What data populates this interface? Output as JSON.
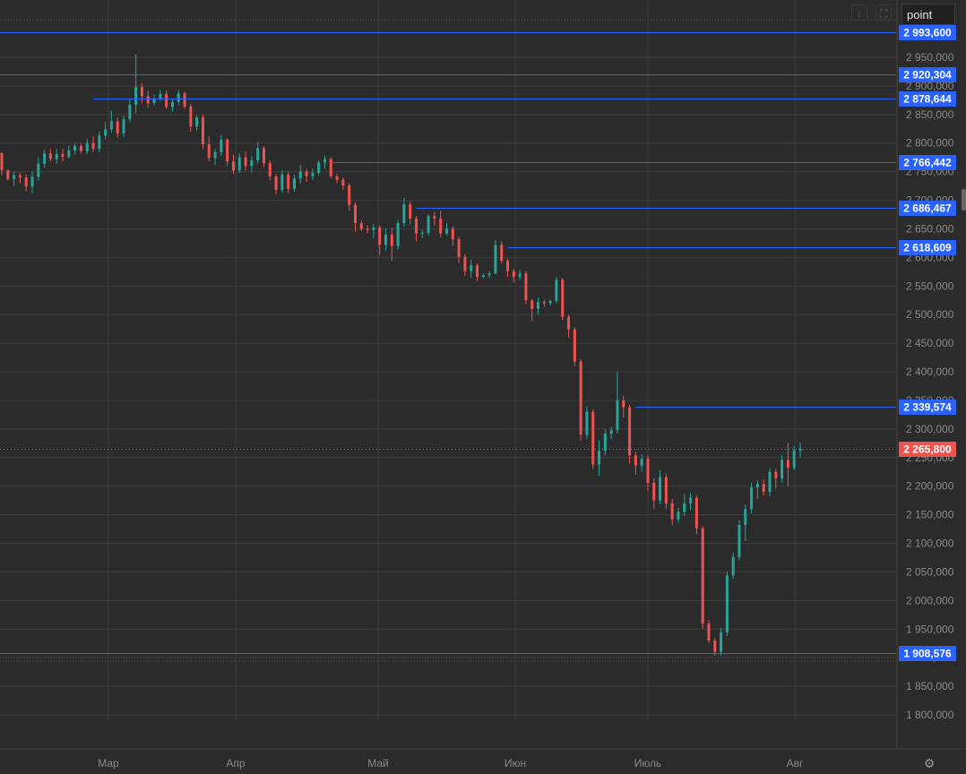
{
  "toolbar": {
    "symbol": "point",
    "download_icon": "download-icon",
    "fullscreen_icon": "fullscreen-icon",
    "settings_icon": "gear-icon"
  },
  "colors": {
    "background": "#2b2b2b",
    "grid": "#3f3f3f",
    "up": "#26a69a",
    "down": "#ef5350",
    "level_line": "#2962ff",
    "level_badge": "#2962ff",
    "price_badge": "#ef5350",
    "axis_text": "#8a8a8a"
  },
  "chart_data": {
    "type": "candlestick",
    "y_range": [
      1765000,
      3020000
    ],
    "y_ticks": [
      "1 800,000",
      "1 850,000",
      "1 900,000",
      "1 950,000",
      "2 000,000",
      "2 050,000",
      "2 100,000",
      "2 150,000",
      "2 200,000",
      "2 250,000",
      "2 300,000",
      "2 350,000",
      "2 400,000",
      "2 450,000",
      "2 500,000",
      "2 550,000",
      "2 600,000",
      "2 650,000",
      "2 700,000",
      "2 750,000",
      "2 800,000",
      "2 850,000",
      "2 900,000",
      "2 950,000"
    ],
    "x_ticks": [
      "Мар",
      "Апр",
      "Май",
      "Июн",
      "Июль",
      "Авг"
    ],
    "levels": [
      {
        "label": "2 993,600",
        "value": 2993600,
        "from": 0
      },
      {
        "label": "2 920,304",
        "value": 2920304,
        "from": 0
      },
      {
        "label": "2 878,644",
        "value": 2878644,
        "from": 15
      },
      {
        "label": "2 766,442",
        "value": 2766442,
        "from": 54
      },
      {
        "label": "2 686,467",
        "value": 2686467,
        "from": 68
      },
      {
        "label": "2 618,609",
        "value": 2618609,
        "from": 83
      },
      {
        "label": "2 339,574",
        "value": 2339574,
        "from": 104
      },
      {
        "label": "1 908,576",
        "value": 1908576,
        "from": 0
      }
    ],
    "current_price": {
      "label": "2 265,800",
      "value": 2265800
    },
    "candles": [
      [
        2783000,
        2783000,
        2744000,
        2753000
      ],
      [
        2753000,
        2752000,
        2734000,
        2737000
      ],
      [
        2737000,
        2751000,
        2725000,
        2744000
      ],
      [
        2744000,
        2748000,
        2730000,
        2740000
      ],
      [
        2740000,
        2745000,
        2716000,
        2724000
      ],
      [
        2724000,
        2750000,
        2712000,
        2741000
      ],
      [
        2741000,
        2775000,
        2735000,
        2764000
      ],
      [
        2764000,
        2788000,
        2757000,
        2782000
      ],
      [
        2782000,
        2790000,
        2768000,
        2772000
      ],
      [
        2772000,
        2790000,
        2764000,
        2781000
      ],
      [
        2781000,
        2790000,
        2768000,
        2776000
      ],
      [
        2776000,
        2795000,
        2773000,
        2787000
      ],
      [
        2787000,
        2800000,
        2780000,
        2795000
      ],
      [
        2795000,
        2800000,
        2782000,
        2786000
      ],
      [
        2786000,
        2807000,
        2781000,
        2800000
      ],
      [
        2800000,
        2812000,
        2785000,
        2790000
      ],
      [
        2790000,
        2820000,
        2784000,
        2813000
      ],
      [
        2813000,
        2837000,
        2806000,
        2824000
      ],
      [
        2824000,
        2857000,
        2818000,
        2838000
      ],
      [
        2838000,
        2845000,
        2810000,
        2817000
      ],
      [
        2817000,
        2848000,
        2811000,
        2842000
      ],
      [
        2842000,
        2878000,
        2837000,
        2867000
      ],
      [
        2867000,
        2955000,
        2852000,
        2898000
      ],
      [
        2898000,
        2905000,
        2870000,
        2882000
      ],
      [
        2882000,
        2892000,
        2862000,
        2870000
      ],
      [
        2870000,
        2885000,
        2866000,
        2878000
      ],
      [
        2878000,
        2893000,
        2874000,
        2886000
      ],
      [
        2886000,
        2892000,
        2860000,
        2863000
      ],
      [
        2863000,
        2878000,
        2855000,
        2872000
      ],
      [
        2872000,
        2893000,
        2866000,
        2887000
      ],
      [
        2887000,
        2890000,
        2860000,
        2864000
      ],
      [
        2864000,
        2869000,
        2820000,
        2829000
      ],
      [
        2829000,
        2849000,
        2822000,
        2845000
      ],
      [
        2845000,
        2850000,
        2790000,
        2798000
      ],
      [
        2798000,
        2812000,
        2768000,
        2774000
      ],
      [
        2774000,
        2790000,
        2762000,
        2784000
      ],
      [
        2784000,
        2815000,
        2777000,
        2806000
      ],
      [
        2806000,
        2808000,
        2760000,
        2768000
      ],
      [
        2768000,
        2780000,
        2746000,
        2752000
      ],
      [
        2752000,
        2782000,
        2748000,
        2775000
      ],
      [
        2775000,
        2786000,
        2752000,
        2760000
      ],
      [
        2760000,
        2778000,
        2749000,
        2770000
      ],
      [
        2770000,
        2802000,
        2764000,
        2791000
      ],
      [
        2791000,
        2795000,
        2758000,
        2765000
      ],
      [
        2765000,
        2770000,
        2735000,
        2742000
      ],
      [
        2742000,
        2746000,
        2710000,
        2718000
      ],
      [
        2718000,
        2753000,
        2713000,
        2745000
      ],
      [
        2745000,
        2750000,
        2712000,
        2720000
      ],
      [
        2720000,
        2745000,
        2715000,
        2738000
      ],
      [
        2738000,
        2762000,
        2730000,
        2750000
      ],
      [
        2750000,
        2755000,
        2732000,
        2742000
      ],
      [
        2742000,
        2755000,
        2736000,
        2748000
      ],
      [
        2748000,
        2770000,
        2744000,
        2766000
      ],
      [
        2766000,
        2778000,
        2755000,
        2772000
      ],
      [
        2772000,
        2775000,
        2738000,
        2742000
      ],
      [
        2742000,
        2746000,
        2730000,
        2736000
      ],
      [
        2736000,
        2740000,
        2718000,
        2726000
      ],
      [
        2726000,
        2730000,
        2682000,
        2692000
      ],
      [
        2692000,
        2696000,
        2645000,
        2660000
      ],
      [
        2660000,
        2665000,
        2646000,
        2650000
      ],
      [
        2650000,
        2656000,
        2642000,
        2648000
      ],
      [
        2648000,
        2658000,
        2634000,
        2652000
      ],
      [
        2652000,
        2656000,
        2604000,
        2622000
      ],
      [
        2622000,
        2650000,
        2612000,
        2640000
      ],
      [
        2640000,
        2652000,
        2594000,
        2620000
      ],
      [
        2620000,
        2666000,
        2614000,
        2660000
      ],
      [
        2660000,
        2704000,
        2654000,
        2693000
      ],
      [
        2693000,
        2698000,
        2658000,
        2668000
      ],
      [
        2668000,
        2672000,
        2628000,
        2642000
      ],
      [
        2642000,
        2648000,
        2634000,
        2643000
      ],
      [
        2643000,
        2676000,
        2638000,
        2672000
      ],
      [
        2672000,
        2680000,
        2656000,
        2668000
      ],
      [
        2668000,
        2682000,
        2636000,
        2642000
      ],
      [
        2642000,
        2660000,
        2638000,
        2650000
      ],
      [
        2650000,
        2655000,
        2620000,
        2632000
      ],
      [
        2632000,
        2636000,
        2590000,
        2601000
      ],
      [
        2601000,
        2606000,
        2568000,
        2576000
      ],
      [
        2576000,
        2596000,
        2564000,
        2586000
      ],
      [
        2586000,
        2590000,
        2558000,
        2566000
      ],
      [
        2566000,
        2572000,
        2564000,
        2569000
      ],
      [
        2569000,
        2576000,
        2564000,
        2572000
      ],
      [
        2572000,
        2630000,
        2570000,
        2622000
      ],
      [
        2622000,
        2628000,
        2590000,
        2594000
      ],
      [
        2594000,
        2598000,
        2566000,
        2576000
      ],
      [
        2576000,
        2580000,
        2556000,
        2566000
      ],
      [
        2566000,
        2578000,
        2560000,
        2572000
      ],
      [
        2572000,
        2576000,
        2518000,
        2525000
      ],
      [
        2525000,
        2528000,
        2488000,
        2510000
      ],
      [
        2510000,
        2530000,
        2500000,
        2522000
      ],
      [
        2522000,
        2526000,
        2514000,
        2520000
      ],
      [
        2520000,
        2526000,
        2516000,
        2524000
      ],
      [
        2524000,
        2566000,
        2520000,
        2561000
      ],
      [
        2561000,
        2564000,
        2490000,
        2496000
      ],
      [
        2496000,
        2500000,
        2460000,
        2474000
      ],
      [
        2474000,
        2478000,
        2410000,
        2418000
      ],
      [
        2418000,
        2422000,
        2280000,
        2290000
      ],
      [
        2290000,
        2340000,
        2282000,
        2330000
      ],
      [
        2330000,
        2334000,
        2230000,
        2238000
      ],
      [
        2238000,
        2280000,
        2218000,
        2262000
      ],
      [
        2262000,
        2300000,
        2254000,
        2292000
      ],
      [
        2292000,
        2304000,
        2282000,
        2298000
      ],
      [
        2298000,
        2400000,
        2292000,
        2350000
      ],
      [
        2350000,
        2358000,
        2320000,
        2338000
      ],
      [
        2338000,
        2342000,
        2240000,
        2254000
      ],
      [
        2254000,
        2260000,
        2220000,
        2236000
      ],
      [
        2236000,
        2256000,
        2225000,
        2248000
      ],
      [
        2248000,
        2254000,
        2192000,
        2206000
      ],
      [
        2206000,
        2214000,
        2160000,
        2175000
      ],
      [
        2175000,
        2228000,
        2168000,
        2216000
      ],
      [
        2216000,
        2222000,
        2160000,
        2170000
      ],
      [
        2170000,
        2178000,
        2132000,
        2142000
      ],
      [
        2142000,
        2162000,
        2136000,
        2155000
      ],
      [
        2155000,
        2186000,
        2148000,
        2170000
      ],
      [
        2170000,
        2188000,
        2158000,
        2180000
      ],
      [
        2180000,
        2184000,
        2116000,
        2126000
      ],
      [
        2126000,
        2130000,
        1950000,
        1960000
      ],
      [
        1960000,
        1966000,
        1926000,
        1930000
      ],
      [
        1930000,
        1935000,
        1904000,
        1910000
      ],
      [
        1910000,
        1952000,
        1904000,
        1944000
      ],
      [
        1944000,
        2050000,
        1938000,
        2044000
      ],
      [
        2044000,
        2084000,
        2038000,
        2076000
      ],
      [
        2076000,
        2140000,
        2070000,
        2132000
      ],
      [
        2132000,
        2168000,
        2104000,
        2160000
      ],
      [
        2160000,
        2206000,
        2152000,
        2198000
      ],
      [
        2198000,
        2210000,
        2178000,
        2204000
      ],
      [
        2204000,
        2212000,
        2184000,
        2190000
      ],
      [
        2190000,
        2232000,
        2182000,
        2225000
      ],
      [
        2225000,
        2230000,
        2196000,
        2214000
      ],
      [
        2214000,
        2254000,
        2206000,
        2246000
      ],
      [
        2246000,
        2276000,
        2200000,
        2232000
      ],
      [
        2232000,
        2270000,
        2228000,
        2262000
      ],
      [
        2262000,
        2276000,
        2250000,
        2265800
      ]
    ]
  }
}
